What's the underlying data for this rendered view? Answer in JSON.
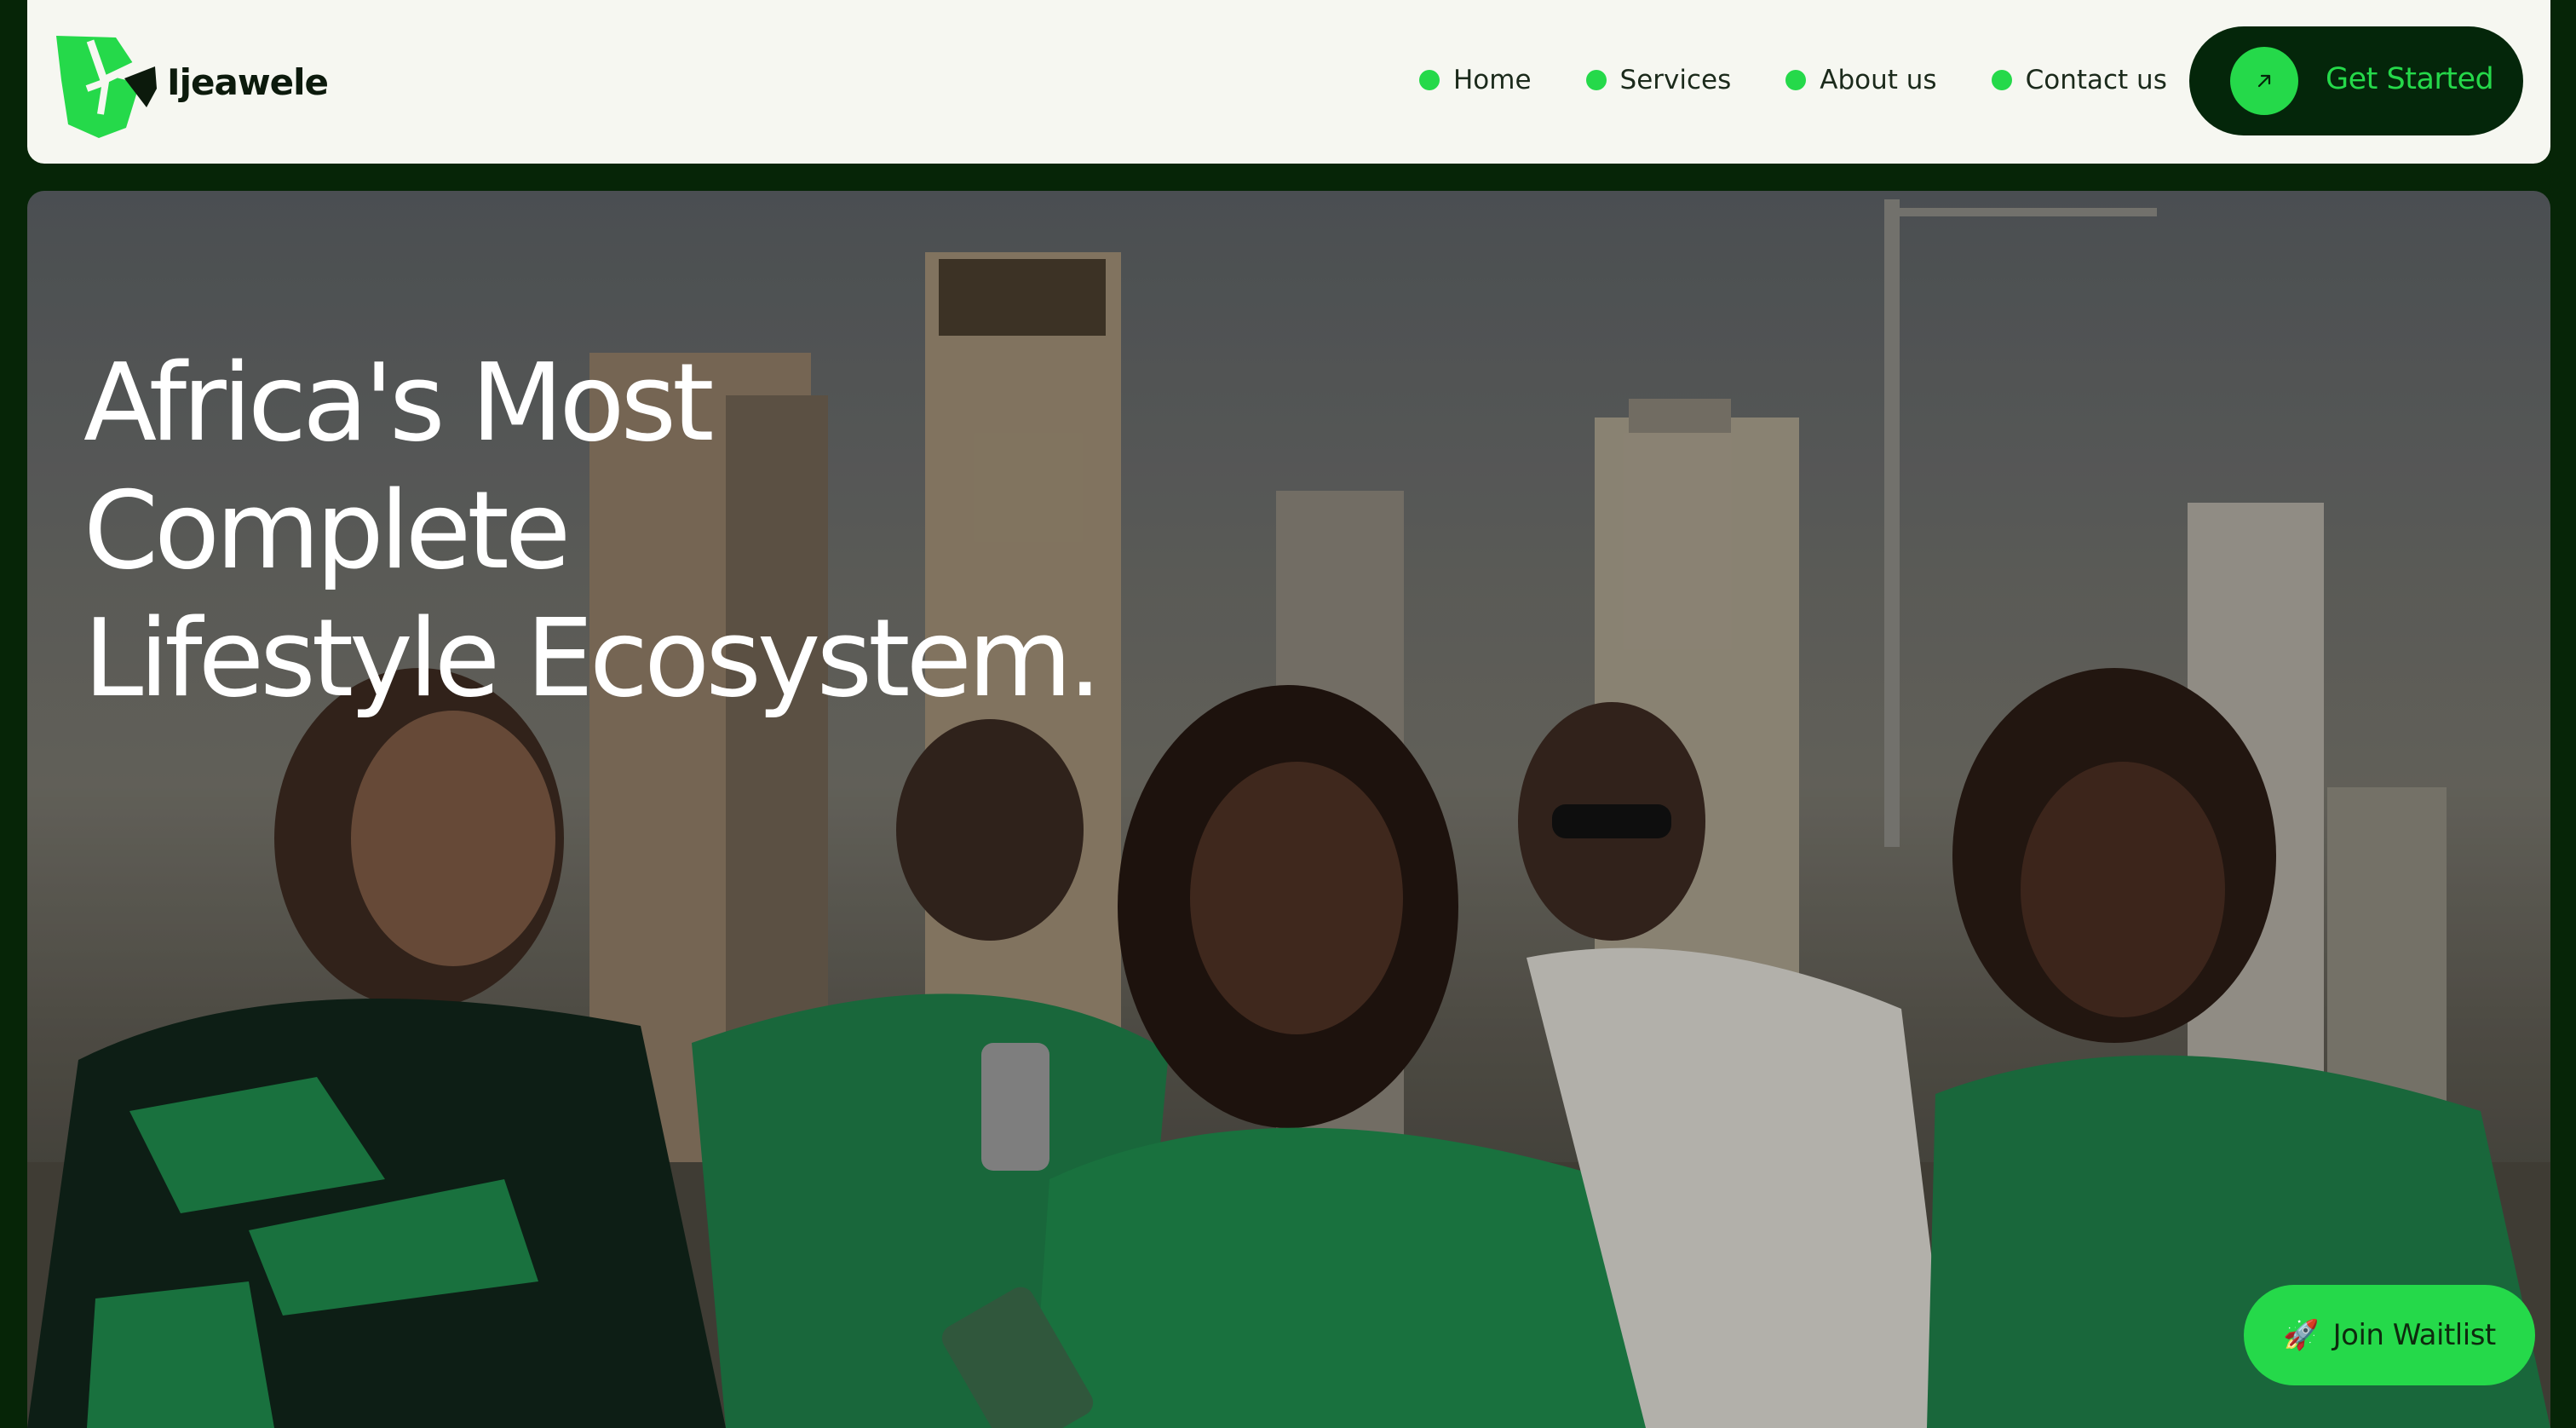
{
  "brand": {
    "name": "Ijeawele",
    "logo_icon": "shield-leaf-logo-icon",
    "colors": {
      "accent": "#25d94a",
      "dark": "#04260a",
      "nav_bg": "#f6f7f1"
    }
  },
  "nav": {
    "items": [
      {
        "label": "Home",
        "icon": "green-dot-icon"
      },
      {
        "label": "Services",
        "icon": "green-dot-icon"
      },
      {
        "label": "About us",
        "icon": "green-dot-icon"
      },
      {
        "label": "Contact us",
        "icon": "green-dot-icon"
      }
    ],
    "cta": {
      "label": "Get Started",
      "icon": "arrow-up-right-icon"
    }
  },
  "hero": {
    "headline": [
      "Africa's Most",
      "Complete",
      "Lifestyle Ecosystem."
    ],
    "image": "group-of-young-people-in-green-shirts-holding-phones-city-skyline"
  },
  "waitlist": {
    "label": "Join Waitlist",
    "icon": "rocket-icon",
    "emoji": "🚀"
  }
}
